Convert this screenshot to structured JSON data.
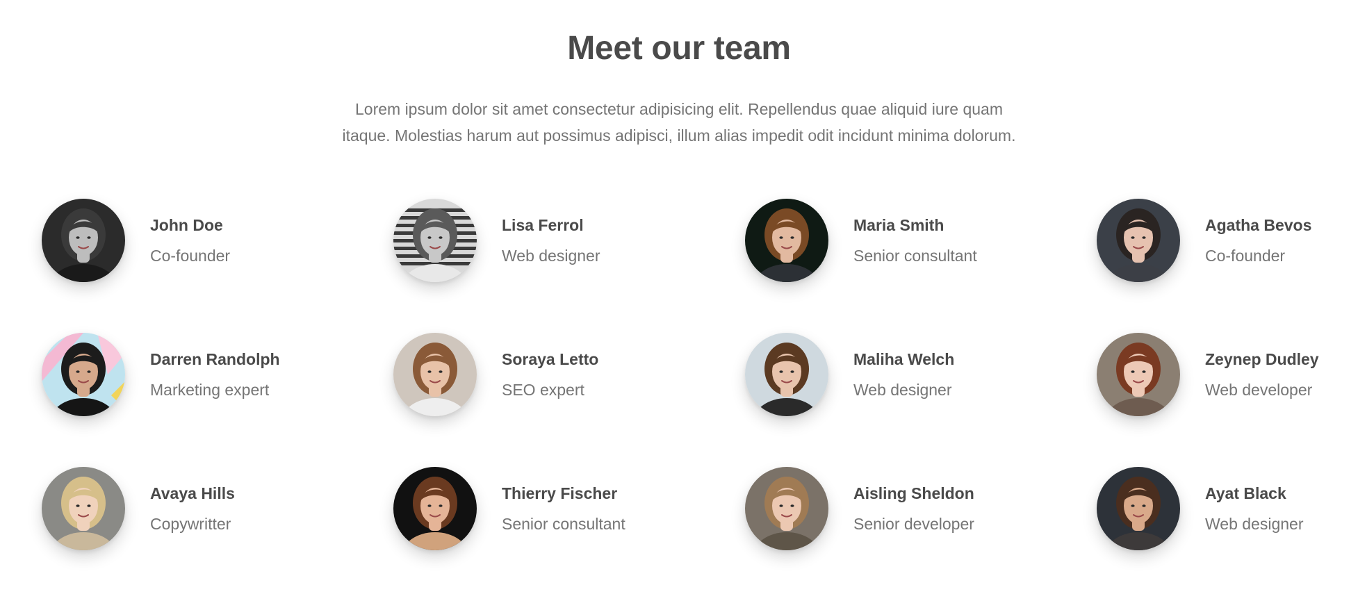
{
  "header": {
    "title": "Meet our team",
    "description_line1": "Lorem ipsum dolor sit amet consectetur adipisicing elit. Repellendus quae aliquid iure quam",
    "description_line2": "itaque. Molestias harum aut possimus adipisci, illum alias impedit odit incidunt minima dolorum."
  },
  "team": [
    {
      "name": "John Doe",
      "role": "Co-founder",
      "avatar": {
        "bg": "#2b2b2b",
        "hair": "#3a3a3a",
        "skin": "#bdbdbd",
        "shirt": "#1a1a1a",
        "tone": "grayscale"
      }
    },
    {
      "name": "Lisa Ferrol",
      "role": "Web designer",
      "avatar": {
        "bg": "#d9d9d9",
        "hair": "#5a5a5a",
        "skin": "#c8c8c8",
        "shirt": "#e8e8e8",
        "tone": "grayscale-stripes"
      }
    },
    {
      "name": "Maria Smith",
      "role": "Senior consultant",
      "avatar": {
        "bg": "#0f1a14",
        "hair": "#7a4a25",
        "skin": "#e2b9a0",
        "shirt": "#2c3035",
        "tone": "color"
      }
    },
    {
      "name": "Agatha Bevos",
      "role": "Co-founder",
      "avatar": {
        "bg": "#3b4048",
        "hair": "#2a2422",
        "skin": "#e6c2b0",
        "shirt": "#3c3f46",
        "tone": "color"
      }
    },
    {
      "name": "Darren Randolph",
      "role": "Marketing expert",
      "avatar": {
        "bg": "#bfe3ef",
        "hair": "#1c1c1c",
        "skin": "#d6a98c",
        "shirt": "#151515",
        "tone": "pastel"
      }
    },
    {
      "name": "Soraya Letto",
      "role": "SEO expert",
      "avatar": {
        "bg": "#cfc6bd",
        "hair": "#8a5a38",
        "skin": "#e8c2a8",
        "shirt": "#eeeeee",
        "tone": "color"
      }
    },
    {
      "name": "Maliha Welch",
      "role": "Web designer",
      "avatar": {
        "bg": "#cfd9df",
        "hair": "#5b3a22",
        "skin": "#e8c4ad",
        "shirt": "#2a2a2a",
        "tone": "color"
      }
    },
    {
      "name": "Zeynep Dudley",
      "role": "Web developer",
      "avatar": {
        "bg": "#8b7f72",
        "hair": "#7a3a22",
        "skin": "#edc9b6",
        "shirt": "#6e5c50",
        "tone": "color"
      }
    },
    {
      "name": "Avaya Hills",
      "role": "Copywritter",
      "avatar": {
        "bg": "#8a8a86",
        "hair": "#d6bf8a",
        "skin": "#f0d2bc",
        "shirt": "#c9b89b",
        "tone": "color"
      }
    },
    {
      "name": "Thierry Fischer",
      "role": "Senior consultant",
      "avatar": {
        "bg": "#111111",
        "hair": "#6a3a20",
        "skin": "#e5b497",
        "shirt": "#d0a27c",
        "tone": "color"
      }
    },
    {
      "name": "Aisling Sheldon",
      "role": "Senior developer",
      "avatar": {
        "bg": "#7b7268",
        "hair": "#a07b54",
        "skin": "#ecc8b2",
        "shirt": "#5e5548",
        "tone": "color"
      }
    },
    {
      "name": "Ayat Black",
      "role": "Web designer",
      "avatar": {
        "bg": "#2d3239",
        "hair": "#4a2e1f",
        "skin": "#d9a98a",
        "shirt": "#3d3a3a",
        "tone": "color"
      }
    }
  ]
}
